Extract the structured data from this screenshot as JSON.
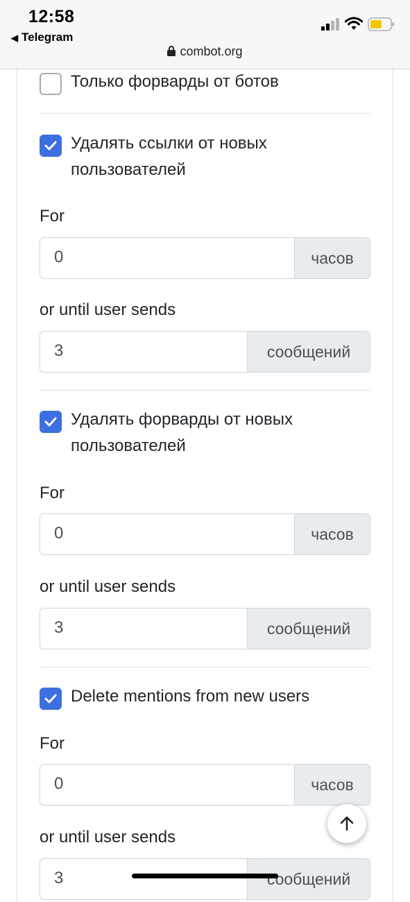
{
  "status": {
    "time": "12:58",
    "back_app": "Telegram",
    "url": "combot.org"
  },
  "colors": {
    "accent": "#3d6fe0",
    "addon_bg": "#e9ecef",
    "border": "#ced4da",
    "battery": "#f5c400"
  },
  "sections": [
    {
      "label": "Только форварды от ботов",
      "checked": false
    },
    {
      "label": "Удалять ссылки от новых пользователей",
      "checked": true,
      "for_label": "For",
      "hours_value": "0",
      "hours_unit": "часов",
      "until_label": "or until user sends",
      "messages_value": "3",
      "messages_unit": "сообщений"
    },
    {
      "label": "Удалять форварды от новых пользователей",
      "checked": true,
      "for_label": "For",
      "hours_value": "0",
      "hours_unit": "часов",
      "until_label": "or until user sends",
      "messages_value": "3",
      "messages_unit": "сообщений"
    },
    {
      "label": "Delete mentions from new users",
      "checked": true,
      "for_label": "For",
      "hours_value": "0",
      "hours_unit": "часов",
      "until_label": "or until user sends",
      "messages_value": "3",
      "messages_unit": "сообщений"
    }
  ],
  "icons": {
    "lock": "lock-icon",
    "signal": "cellular-signal-icon",
    "wifi": "wifi-icon",
    "battery": "battery-icon",
    "scroll_top": "arrow-up-icon",
    "check": "checkmark-icon"
  }
}
